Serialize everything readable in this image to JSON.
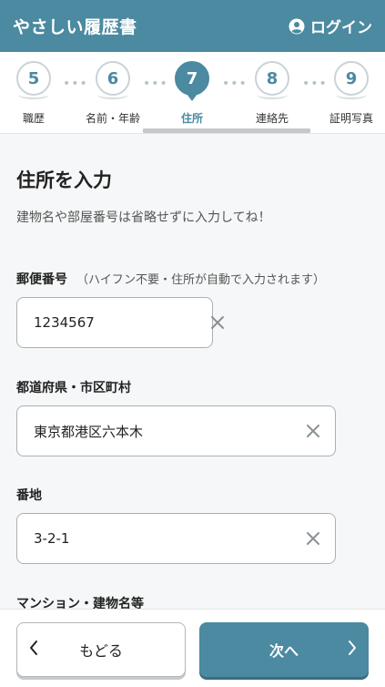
{
  "header": {
    "app_title": "やさしい履歴書",
    "login_label": "ログイン"
  },
  "steps": [
    {
      "number": "5",
      "label": "職歴",
      "active": false
    },
    {
      "number": "6",
      "label": "名前・年齢",
      "active": false
    },
    {
      "number": "7",
      "label": "住所",
      "active": true
    },
    {
      "number": "8",
      "label": "連絡先",
      "active": false
    },
    {
      "number": "9",
      "label": "証明写真",
      "active": false
    }
  ],
  "step_separator": "•••",
  "main": {
    "title": "住所を入力",
    "description": "建物名や部屋番号は省略せずに入力してね！",
    "fields": {
      "postal": {
        "label": "郵便番号",
        "hint": "（ハイフン不要・住所が自動で入力されます）",
        "value": "1234567"
      },
      "prefecture_city": {
        "label": "都道府県・市区町村",
        "value": "東京都港区六本木"
      },
      "street": {
        "label": "番地",
        "value": "3-2-1"
      },
      "building": {
        "label": "マンション・建物名等"
      }
    }
  },
  "footer": {
    "back_label": "もどる",
    "next_label": "次へ"
  },
  "colors": {
    "accent": "#4b8aa0",
    "background": "#f6f7f8"
  },
  "icons": {
    "login": "user-circle-icon",
    "clear": "close-icon",
    "back": "chevron-left-icon",
    "next": "chevron-right-icon"
  }
}
